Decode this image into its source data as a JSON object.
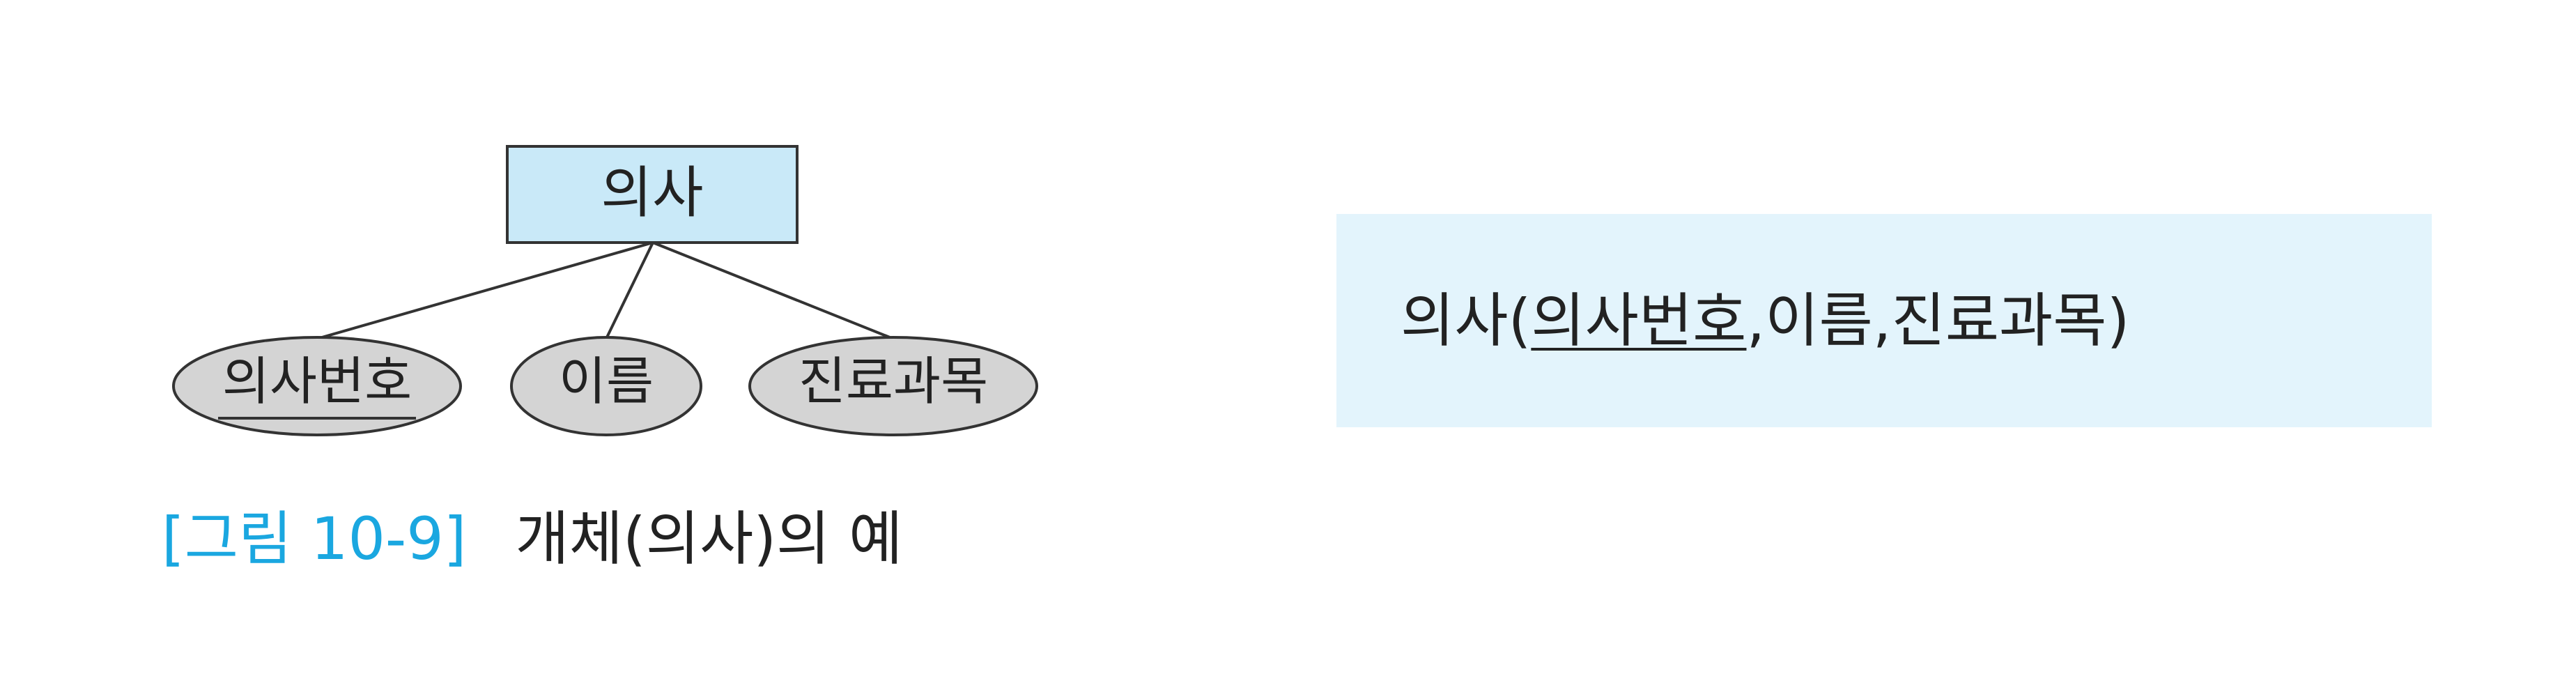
{
  "entity": {
    "name": "의사",
    "fill": "#c9e9f8",
    "stroke": "#333333"
  },
  "attributes": [
    {
      "name": "의사번호",
      "is_key": true
    },
    {
      "name": "이름",
      "is_key": false
    },
    {
      "name": "진료과목",
      "is_key": false
    }
  ],
  "attribute_fill": "#d4d4d4",
  "caption": {
    "label": "[그림 10-9]",
    "text": "개체(의사)의 예",
    "label_color": "#1aa7e0"
  },
  "relation": {
    "name": "의사",
    "open": "(",
    "key": "의사번호",
    "separator": ",",
    "fields": [
      "이름",
      "진료과목"
    ],
    "close": ")",
    "panel_color": "#e3f4fc"
  }
}
